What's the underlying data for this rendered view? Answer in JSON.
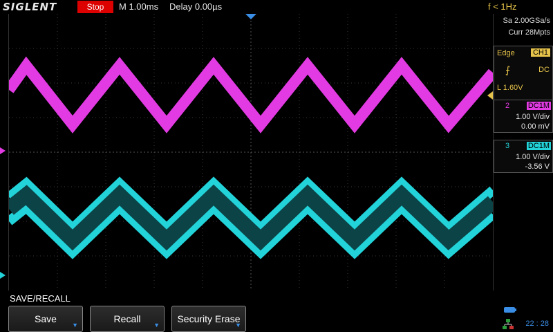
{
  "topbar": {
    "brand": "SIGLENT",
    "run_state": "Stop",
    "timebase": "M 1.00ms",
    "delay": "Delay 0.00µs",
    "frequency": "f < 1Hz"
  },
  "acquisition": {
    "sample_rate": "Sa 2.00GSa/s",
    "memory_depth": "Curr 28Mpts"
  },
  "trigger": {
    "type": "Edge",
    "source": "CH1",
    "coupling": "DC",
    "level": "L  1.60V"
  },
  "channels": [
    {
      "number": "2",
      "coupling": "DC1M",
      "volts_per_div": "1.00 V/div",
      "offset": "0.00 mV",
      "color": "#e23be3"
    },
    {
      "number": "3",
      "coupling": "DC1M",
      "volts_per_div": "1.00 V/div",
      "offset": "-3.56 V",
      "color": "#22d3d9"
    }
  ],
  "menu": {
    "title": "SAVE/RECALL",
    "softkeys": [
      {
        "label": "Save"
      },
      {
        "label": "Recall"
      },
      {
        "label": "Security Erase"
      }
    ]
  },
  "status": {
    "clock": "22 : 28"
  },
  "colors": {
    "ch2": "#e23be3",
    "ch3": "#22d3d9",
    "trigger": "#e6c34a",
    "accent": "#3a8ee6",
    "stop": "#dd0000"
  }
}
